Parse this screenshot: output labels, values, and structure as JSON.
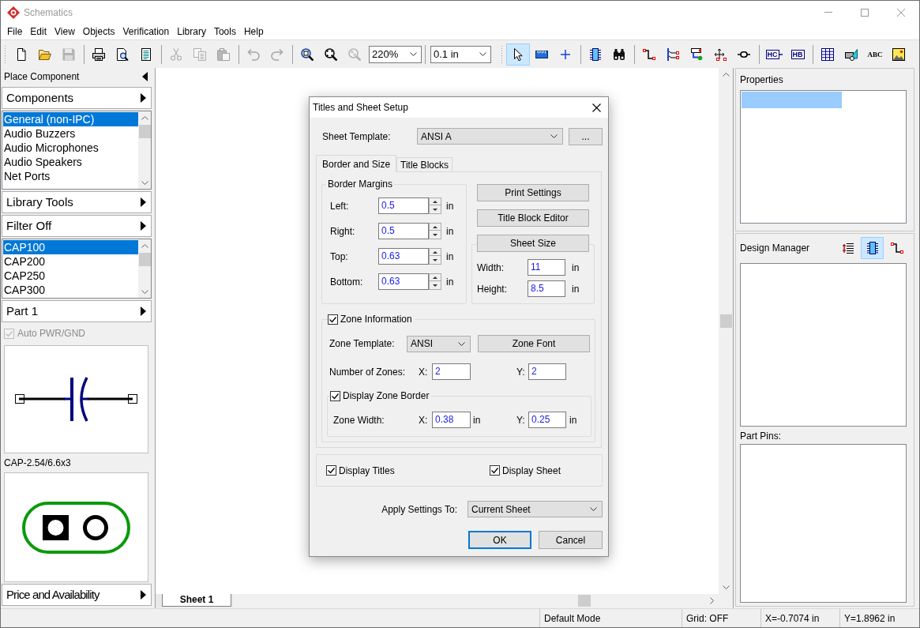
{
  "window": {
    "title": "Schematics"
  },
  "menu": [
    "File",
    "Edit",
    "View",
    "Objects",
    "Verification",
    "Library",
    "Tools",
    "Help"
  ],
  "toolbars": [
    {
      "groups": [
        [
          {
            "kind": "new",
            "disabled": false
          },
          {
            "kind": "open",
            "disabled": false
          },
          {
            "kind": "save",
            "disabled": true
          }
        ],
        [
          {
            "kind": "print",
            "disabled": false
          },
          {
            "kind": "print_preview",
            "disabled": false
          },
          {
            "kind": "report",
            "disabled": false
          }
        ],
        [
          {
            "kind": "cut",
            "disabled": true
          },
          {
            "kind": "copy",
            "disabled": true
          },
          {
            "kind": "paste",
            "disabled": true
          }
        ],
        [
          {
            "kind": "undo",
            "disabled": true
          },
          {
            "kind": "redo",
            "disabled": true
          }
        ],
        [
          {
            "kind": "zoom_in",
            "disabled": false
          },
          {
            "kind": "zoom_out",
            "disabled": false
          },
          {
            "kind": "zoom_fit",
            "disabled": true
          },
          {
            "kind": "zoom_combo",
            "value": "220%"
          }
        ],
        [
          {
            "kind": "grid_combo",
            "value": "0.1 in"
          }
        ]
      ]
    },
    {
      "groups": [
        [
          {
            "kind": "select",
            "selected": true
          },
          {
            "kind": "ruler",
            "selected": false
          },
          {
            "kind": "junction",
            "selected": false
          }
        ],
        [
          {
            "kind": "part",
            "selected": false
          },
          {
            "kind": "find",
            "selected": false
          }
        ],
        [
          {
            "kind": "wire",
            "selected": false
          },
          {
            "kind": "bus",
            "selected": false
          },
          {
            "kind": "net_flag",
            "selected": false
          },
          {
            "kind": "move",
            "selected": false
          },
          {
            "kind": "connector",
            "selected": false
          }
        ],
        [
          {
            "kind": "hc",
            "label": "HC",
            "selected": false
          },
          {
            "kind": "hb",
            "label": "HB",
            "selected": false
          }
        ],
        [
          {
            "kind": "table",
            "selected": false
          },
          {
            "kind": "shapes",
            "selected": false
          },
          {
            "kind": "text",
            "label": "ABC",
            "selected": false
          },
          {
            "kind": "picture",
            "selected": false
          }
        ]
      ]
    }
  ],
  "left_panel": {
    "title": "Place Component",
    "components": "Components",
    "categories": [
      {
        "label": "General (non-IPC)",
        "selected": true
      },
      {
        "label": "Audio Buzzers",
        "selected": false
      },
      {
        "label": "Audio Microphones",
        "selected": false
      },
      {
        "label": "Audio Speakers",
        "selected": false
      },
      {
        "label": "Net Ports",
        "selected": false
      }
    ],
    "library_tools": "Library Tools",
    "filter": "Filter Off",
    "parts": [
      {
        "label": "CAP100",
        "selected": true
      },
      {
        "label": "CAP200",
        "selected": false
      },
      {
        "label": "CAP250",
        "selected": false
      },
      {
        "label": "CAP300",
        "selected": false
      }
    ],
    "part": "Part 1",
    "auto_pwr_gnd": {
      "label": "Auto PWR/GND",
      "checked": true,
      "disabled": true
    },
    "footprint_name": "CAP-2.54/6.6x3",
    "price": "Price and Availability"
  },
  "sheet_tabs": [
    {
      "label": "Sheet 1",
      "selected": true
    }
  ],
  "right_panel": {
    "properties": {
      "title": "Properties"
    },
    "design_manager": {
      "title": "Design Manager",
      "tabs": [
        {
          "kind": "nets",
          "selected": false
        },
        {
          "kind": "parts",
          "selected": true
        },
        {
          "kind": "wires",
          "selected": false
        }
      ]
    },
    "part_pins": {
      "title": "Part Pins:"
    }
  },
  "status_bar": [
    "Default Mode",
    "Grid: OFF",
    "X=-0.7074 in",
    "Y=1.8962 in"
  ],
  "dialog": {
    "title": "Titles and Sheet Setup",
    "sheet_template": {
      "label": "Sheet Template:",
      "value": "ANSI A"
    },
    "browse_button": "...",
    "tabs": [
      {
        "label": "Border and Size",
        "selected": true
      },
      {
        "label": "Title Blocks",
        "selected": false
      }
    ],
    "border_margins": {
      "title": "Border Margins",
      "fields": [
        {
          "label": "Left:",
          "value": "0.5",
          "unit": "in"
        },
        {
          "label": "Right:",
          "value": "0.5",
          "unit": "in"
        },
        {
          "label": "Top:",
          "value": "0.63",
          "unit": "in"
        },
        {
          "label": "Bottom:",
          "value": "0.63",
          "unit": "in"
        }
      ]
    },
    "buttons": [
      "Print Settings",
      "Title Block Editor"
    ],
    "sheet_size": {
      "button": "Sheet Size",
      "fields": [
        {
          "label": "Width:",
          "value": "11",
          "unit": "in"
        },
        {
          "label": "Height:",
          "value": "8.5",
          "unit": "in"
        }
      ]
    },
    "zone_information": {
      "label": "Zone Information",
      "checked": true,
      "template": {
        "label": "Zone Template:",
        "value": "ANSI"
      },
      "font_button": "Zone Font",
      "number_of_zones": {
        "label": "Number of Zones:",
        "x": {
          "label": "X:",
          "value": "2"
        },
        "y": {
          "label": "Y:",
          "value": "2"
        }
      },
      "display_zone_border": {
        "label": "Display Zone Border",
        "checked": true
      },
      "zone_width": {
        "label": "Zone Width:",
        "x": {
          "label": "X:",
          "value": "0.38",
          "unit": "in"
        },
        "y": {
          "label": "Y:",
          "value": "0.25",
          "unit": "in"
        }
      }
    },
    "display_titles": {
      "label": "Display Titles",
      "checked": true
    },
    "display_sheet": {
      "label": "Display Sheet",
      "checked": true
    },
    "apply_to": {
      "label": "Apply Settings To:",
      "value": "Current Sheet"
    },
    "ok_button": "OK",
    "cancel_button": "Cancel"
  }
}
